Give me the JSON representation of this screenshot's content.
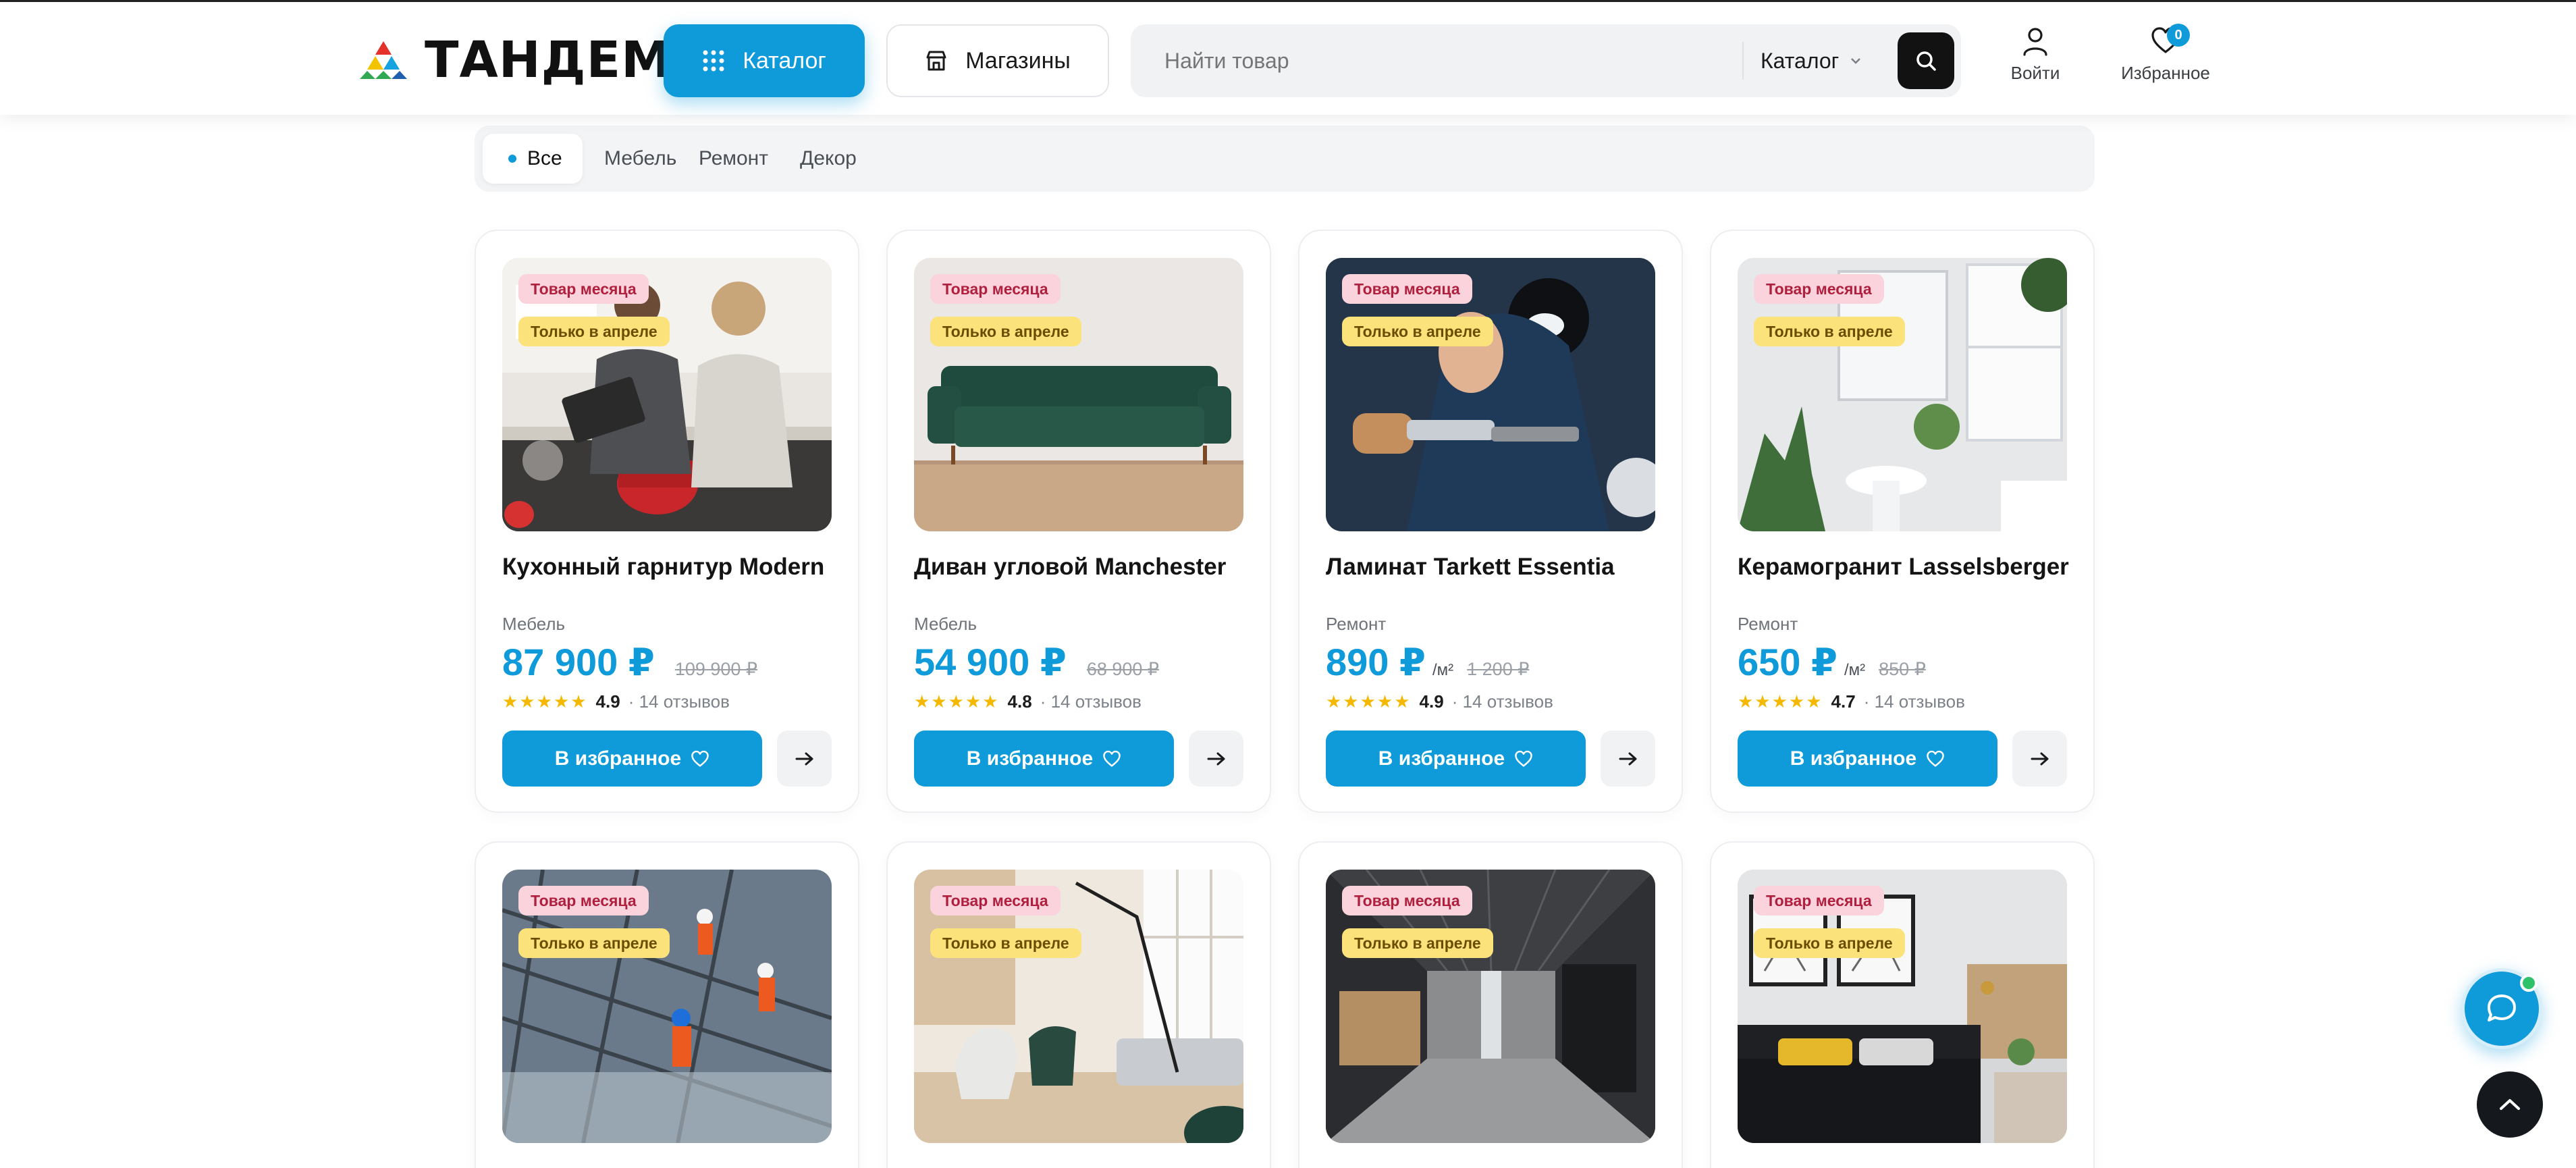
{
  "brand": {
    "name": "ТАНДЕМ"
  },
  "header": {
    "catalog_label": "Каталог",
    "shops_label": "Магазины",
    "search": {
      "placeholder": "Найти товар",
      "scope": "Каталог"
    },
    "login_label": "Войти",
    "favorites_label": "Избранное",
    "favorites_count": "0"
  },
  "filters": [
    {
      "label": "Все",
      "active": true
    },
    {
      "label": "Мебель",
      "active": false
    },
    {
      "label": "Ремонт",
      "active": false
    },
    {
      "label": "Декор",
      "active": false
    }
  ],
  "badges": {
    "month": "Товар месяца",
    "april": "Только в апреле"
  },
  "buttons": {
    "favorite": "В избранное"
  },
  "products": [
    {
      "title": "Кухонный гарнитур Modern",
      "category": "Мебель",
      "price": "87 900 ₽",
      "unit": "",
      "old_price": "109 900 ₽",
      "rating": "4.9",
      "reviews": "· 14 отзывов",
      "image": "kitchen-couple-cooking"
    },
    {
      "title": "Диван угловой Manchester",
      "category": "Мебель",
      "price": "54 900 ₽",
      "unit": "",
      "old_price": "68 900 ₽",
      "rating": "4.8",
      "reviews": "· 14 отзывов",
      "image": "green-velvet-sofa"
    },
    {
      "title": "Ламинат Tarkett Essentia",
      "category": "Ремонт",
      "price": "890 ₽",
      "unit": "/м²",
      "old_price": "1 200 ₽",
      "rating": "4.9",
      "reviews": "· 14 отзывов",
      "image": "worker-with-brush"
    },
    {
      "title": "Керамогранит Lasselsberger",
      "category": "Ремонт",
      "price": "650 ₽",
      "unit": "/м²",
      "old_price": "850 ₽",
      "rating": "4.7",
      "reviews": "· 14 отзывов",
      "image": "white-bathroom-plants"
    },
    {
      "image": "construction-workers-rebar"
    },
    {
      "image": "scandinavian-living-room"
    },
    {
      "image": "office-corridor-grey"
    },
    {
      "image": "bedroom-dark-headboard"
    }
  ],
  "colors": {
    "accent": "#0f9ad9",
    "badge_month_bg": "#fbd3dc",
    "badge_april_bg": "#fbe27a",
    "dark": "#15181c"
  }
}
